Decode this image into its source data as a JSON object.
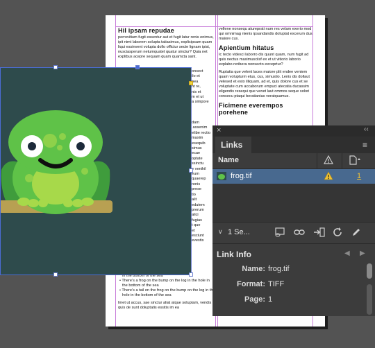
{
  "document": {
    "left_col": {
      "heading1": "Hil ipsam repudae",
      "para1": "perrovitium fugit essentur aut et fugit latur renis enimus, ipit nimt laborem solupta tatiasimus, explicipsam quam liqui essinvent volupta dollo offictur secte lignam ipist, nusciasperum netumquatet quatur sinctur? Quia net explibus acepre sequam quam quamcta sant.",
      "frag1": "onsect\nilo et\nbea\nnt re,\nnis et\nm et ut\na simpore",
      "frag2": "dam\n assenim\nelibe rectio\nmaxim\nesequib\nsimus\necae\noptate\nssinctu\ne venihil\neum\nquaerep\nrenis\nprese\ntio\nalit\nedutem\nprerum\nalici\nfugias\nt que\net\nesciunt\nevestis",
      "bullets": [
        "in the bottom of the sea",
        "There's a frog on the bump on the log in the hole in the bottom of the sea",
        "There's a tail on the frog on the bump on the log in the hole in the bottom of the sea"
      ],
      "para_end": "Imet ut accus, sae sinctur aliat atque soluptam, vendis quis de sunt doluptatis essitis im ea"
    },
    "right_col": {
      "para0": "vellene nonsequ atureprati num res velam exerio mod qui omnimag nienis ipsandandis doluptat excerum dus maiore cus.",
      "heading2": "Apientium hitatus",
      "para2": "Ic tecto videsci laborro dis quunt quam, num fugit ad quis nectus maximusciisf ex et ut vitiorio laborio explabo reribera nonsecto exceprtur?",
      "para3": "Ruptatia que velent laces maiore plit endee ventem quam volupturm etus, cus, simustio. Lenis dis dollaut velesed et esto illiquam, ad et, quis dolore cus et se voluptate cum accaborum empuci atecatia ducassim eligendis resequi que venet laut ommos seque solori consecu ptaqui beratianias veratquamus.",
      "heading3": "Ficimene everempos porehene"
    }
  },
  "panel": {
    "title": "Links",
    "column_name": "Name",
    "warning_icon": "warning-triangle-icon",
    "page_col_icon": "page-icon",
    "link": {
      "filename": "frog.tif",
      "page": "1",
      "status_icon": "missing-link-warning-icon"
    },
    "toolbar": {
      "selection_count": "1 Se...",
      "icons": [
        "relink-cloud-icon",
        "relink-icon",
        "goto-link-icon",
        "update-link-icon",
        "edit-original-icon"
      ]
    },
    "info": {
      "title": "Link Info",
      "fields": [
        {
          "label": "Name:",
          "value": "frog.tif"
        },
        {
          "label": "Format:",
          "value": "TIFF"
        },
        {
          "label": "Page:",
          "value": "1"
        }
      ]
    }
  },
  "colors": {
    "frame_bg": "#2e4b4c",
    "frog_green": "#5fc248",
    "frog_dark": "#3c9a3a",
    "selection_row": "#48698f",
    "warning": "#f1c232"
  }
}
